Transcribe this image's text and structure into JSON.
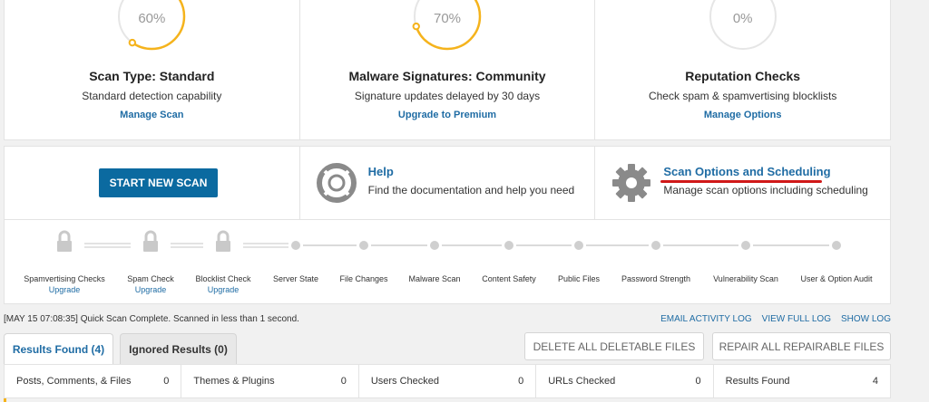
{
  "cards": [
    {
      "percent": 0.6,
      "percent_label": "60%",
      "title": "Scan Type: Standard",
      "subtitle": "Standard detection capability",
      "link": "Manage Scan"
    },
    {
      "percent": 0.7,
      "percent_label": "70%",
      "title": "Malware Signatures: Community",
      "subtitle": "Signature updates delayed by 30 days",
      "link": "Upgrade to Premium"
    },
    {
      "percent": 0,
      "percent_label": "0%",
      "title": "Reputation Checks",
      "subtitle": "Check spam & spamvertising blocklists",
      "link": "Manage Options"
    }
  ],
  "actions": {
    "start_scan_label": "START NEW SCAN",
    "help_title": "Help",
    "help_subtitle": "Find the documentation and help you need",
    "options_title": "Scan Options and Scheduling",
    "options_subtitle": "Manage scan options including scheduling"
  },
  "stages": [
    {
      "label": "Spamvertising Checks",
      "link": "Upgrade",
      "locked": true
    },
    {
      "label": "Spam Check",
      "link": "Upgrade",
      "locked": true
    },
    {
      "label": "Blocklist Check",
      "link": "Upgrade",
      "locked": true
    },
    {
      "label": "Server State",
      "locked": false
    },
    {
      "label": "File Changes",
      "locked": false
    },
    {
      "label": "Malware Scan",
      "locked": false
    },
    {
      "label": "Content Safety",
      "locked": false
    },
    {
      "label": "Public Files",
      "locked": false
    },
    {
      "label": "Password Strength",
      "locked": false
    },
    {
      "label": "Vulnerability Scan",
      "locked": false
    },
    {
      "label": "User & Option Audit",
      "locked": false
    }
  ],
  "status": {
    "message": "[MAY 15 07:08:35] Quick Scan Complete. Scanned in less than 1 second.",
    "email_log": "EMAIL ACTIVITY LOG",
    "full_log": "VIEW FULL LOG",
    "show_log": "SHOW LOG"
  },
  "tabs": {
    "results_found": "Results Found (4)",
    "ignored_results": "Ignored Results (0)"
  },
  "buttons": {
    "delete_all": "DELETE ALL DELETABLE FILES",
    "repair_all": "REPAIR ALL REPAIRABLE FILES"
  },
  "counts": [
    {
      "label": "Posts, Comments, & Files",
      "value": "0"
    },
    {
      "label": "Themes & Plugins",
      "value": "0"
    },
    {
      "label": "Users Checked",
      "value": "0"
    },
    {
      "label": "URLs Checked",
      "value": "0"
    },
    {
      "label": "Results Found",
      "value": "4"
    }
  ],
  "colors": {
    "accent": "#f5b31c",
    "link": "#1f6ca4",
    "primary_button": "#0b6aa0",
    "annotation": "#d01818"
  }
}
